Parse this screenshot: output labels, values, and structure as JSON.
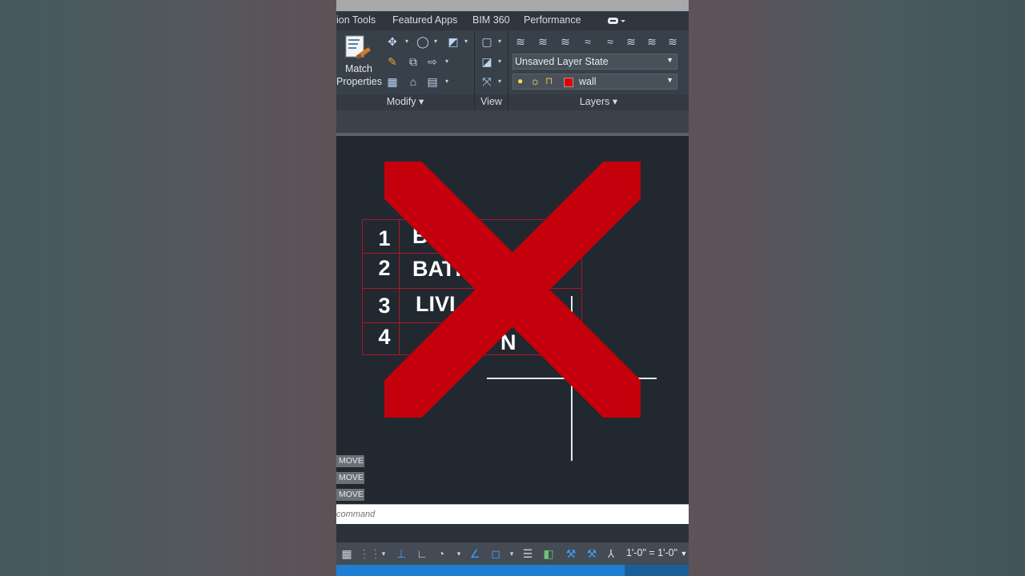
{
  "tabs": [
    "ion Tools",
    "Featured Apps",
    "BIM 360",
    "Performance"
  ],
  "tab_overflow_icon": "ribbon-toggle-icon",
  "match_properties": {
    "line1": "Match",
    "line2": "Properties"
  },
  "panels": {
    "modify": "Modify",
    "view": "View",
    "layers": "Layers"
  },
  "panel_arrow": "▾",
  "layer_state": "Unsaved Layer State",
  "layer": {
    "name": "wall",
    "color": "#e00000"
  },
  "drawing_table": {
    "rows": [
      {
        "num": "1",
        "text": "B          OM"
      },
      {
        "num": "2",
        "text": "BATH"
      },
      {
        "num": "3",
        "text": "LIVI"
      },
      {
        "num": "4",
        "text": "N"
      }
    ]
  },
  "overlay_x_color": "#c4000d",
  "command_history": [
    "MOVE",
    "MOVE",
    "MOVE"
  ],
  "command_placeholder": "command",
  "status": {
    "scale": "1'-0\" = 1'-0\""
  }
}
